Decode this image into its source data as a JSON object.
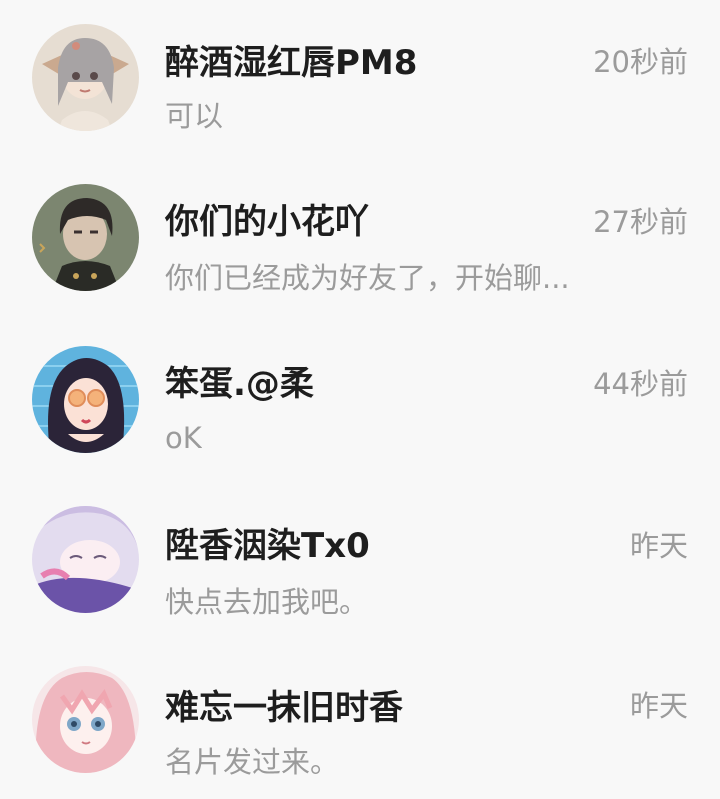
{
  "conversations": [
    {
      "name": "醉酒湿红唇PM8",
      "time": "20秒前",
      "preview": "可以"
    },
    {
      "name": "你们的小花吖",
      "time": "27秒前",
      "preview": "你们已经成为好友了，开始聊..."
    },
    {
      "name": "笨蛋.@柔",
      "time": "44秒前",
      "preview": "oK"
    },
    {
      "name": "陞香洇染Tx0",
      "time": "昨天",
      "preview": "快点去加我吧。"
    },
    {
      "name": "难忘一抹旧时香",
      "time": "昨天",
      "preview": "名片发过来。"
    }
  ]
}
